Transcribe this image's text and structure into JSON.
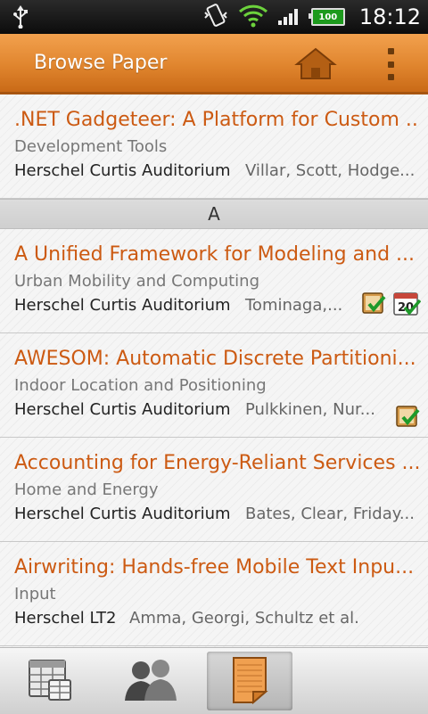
{
  "status_bar": {
    "time": "18:12",
    "battery": "100",
    "icons": [
      "usb-icon",
      "vibrate-icon",
      "wifi-icon",
      "signal-icon",
      "battery-icon"
    ]
  },
  "action_bar": {
    "title": "Browse Paper",
    "icons": [
      "home-icon",
      "overflow-menu-icon"
    ]
  },
  "papers": [
    {
      "title": ".NET Gadgeteer: A Platform for Custom ...",
      "session": "Development Tools",
      "room": "Herschel Curtis Auditorium",
      "authors": "Villar, Scott, Hodge..."
    },
    {
      "title": "A Unified Framework for Modeling and ...",
      "session": "Urban Mobility and Computing",
      "room": "Herschel Curtis Auditorium",
      "authors": "Tominaga,...",
      "badges": [
        "rated-icon",
        "scheduled-calendar-icon"
      ]
    },
    {
      "title": "AWESOM: Automatic Discrete Partitioni...",
      "session": "Indoor Location and Positioning",
      "room": "Herschel Curtis Auditorium",
      "authors": "Pulkkinen, Nur...",
      "badges": [
        "rated-icon"
      ]
    },
    {
      "title": "Accounting for Energy-Reliant Services ...",
      "session": "Home and Energy",
      "room": "Herschel Curtis Auditorium",
      "authors": "Bates, Clear, Friday..."
    },
    {
      "title": "Airwriting: Hands-free Mobile Text Inpu...",
      "session": "Input",
      "room": "Herschel LT2",
      "authors": "Amma, Georgi, Schultz et al."
    }
  ],
  "section_header": "A",
  "calendar_day": "20",
  "tabs": [
    {
      "name": "schedule-tab",
      "icon": "schedule-grid-icon"
    },
    {
      "name": "people-tab",
      "icon": "people-icon"
    },
    {
      "name": "papers-tab",
      "icon": "paper-icon",
      "selected": true
    }
  ],
  "colors": {
    "accent": "#e0852e",
    "title_text": "#cc5a12"
  }
}
